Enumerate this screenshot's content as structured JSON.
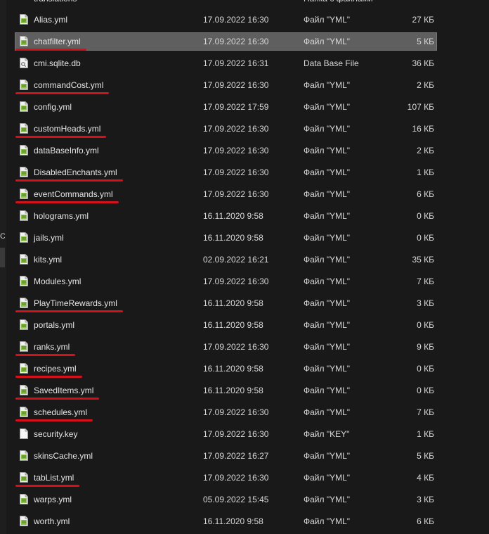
{
  "top_partial": {
    "name": "translations",
    "type": "Папка с файлами"
  },
  "files": [
    {
      "name": "Alias.yml",
      "date": "17.09.2022 16:30",
      "type": "Файл \"YML\"",
      "size": "27 КБ",
      "icon": "yml-file-icon"
    },
    {
      "name": "chatfilter.yml",
      "date": "17.09.2022 16:30",
      "type": "Файл \"YML\"",
      "size": "5 КБ",
      "icon": "yml-file-icon",
      "selected": true,
      "underlined": true
    },
    {
      "name": "cmi.sqlite.db",
      "date": "17.09.2022 16:31",
      "type": "Data Base File",
      "size": "36 КБ",
      "icon": "db-file-icon"
    },
    {
      "name": "commandCost.yml",
      "date": "17.09.2022 16:30",
      "type": "Файл \"YML\"",
      "size": "2 КБ",
      "icon": "yml-file-icon",
      "underlined": true
    },
    {
      "name": "config.yml",
      "date": "17.09.2022 17:59",
      "type": "Файл \"YML\"",
      "size": "107 КБ",
      "icon": "yml-file-icon"
    },
    {
      "name": "customHeads.yml",
      "date": "17.09.2022 16:30",
      "type": "Файл \"YML\"",
      "size": "16 КБ",
      "icon": "yml-file-icon",
      "underlined": true
    },
    {
      "name": "dataBaseInfo.yml",
      "date": "17.09.2022 16:30",
      "type": "Файл \"YML\"",
      "size": "2 КБ",
      "icon": "yml-file-icon"
    },
    {
      "name": "DisabledEnchants.yml",
      "date": "17.09.2022 16:30",
      "type": "Файл \"YML\"",
      "size": "1 КБ",
      "icon": "yml-file-icon",
      "underlined": true
    },
    {
      "name": "eventCommands.yml",
      "date": "17.09.2022 16:30",
      "type": "Файл \"YML\"",
      "size": "6 КБ",
      "icon": "yml-file-icon",
      "underlined": true
    },
    {
      "name": "holograms.yml",
      "date": "16.11.2020 9:58",
      "type": "Файл \"YML\"",
      "size": "0 КБ",
      "icon": "yml-file-icon"
    },
    {
      "name": "jails.yml",
      "date": "16.11.2020 9:58",
      "type": "Файл \"YML\"",
      "size": "0 КБ",
      "icon": "yml-file-icon"
    },
    {
      "name": "kits.yml",
      "date": "02.09.2022 16:21",
      "type": "Файл \"YML\"",
      "size": "35 КБ",
      "icon": "yml-file-icon"
    },
    {
      "name": "Modules.yml",
      "date": "17.09.2022 16:30",
      "type": "Файл \"YML\"",
      "size": "7 КБ",
      "icon": "yml-file-icon"
    },
    {
      "name": "PlayTimeRewards.yml",
      "date": "16.11.2020 9:58",
      "type": "Файл \"YML\"",
      "size": "3 КБ",
      "icon": "yml-file-icon",
      "underlined": true
    },
    {
      "name": "portals.yml",
      "date": "16.11.2020 9:58",
      "type": "Файл \"YML\"",
      "size": "0 КБ",
      "icon": "yml-file-icon"
    },
    {
      "name": "ranks.yml",
      "date": "17.09.2022 16:30",
      "type": "Файл \"YML\"",
      "size": "9 КБ",
      "icon": "yml-file-icon",
      "underlined": true
    },
    {
      "name": "recipes.yml",
      "date": "16.11.2020 9:58",
      "type": "Файл \"YML\"",
      "size": "0 КБ",
      "icon": "yml-file-icon",
      "underlined": true
    },
    {
      "name": "SavedItems.yml",
      "date": "16.11.2020 9:58",
      "type": "Файл \"YML\"",
      "size": "0 КБ",
      "icon": "yml-file-icon",
      "underlined": true
    },
    {
      "name": "schedules.yml",
      "date": "17.09.2022 16:30",
      "type": "Файл \"YML\"",
      "size": "7 КБ",
      "icon": "yml-file-icon",
      "underlined": true
    },
    {
      "name": "security.key",
      "date": "17.09.2022 16:30",
      "type": "Файл \"KEY\"",
      "size": "1 КБ",
      "icon": "blank-file-icon"
    },
    {
      "name": "skinsCache.yml",
      "date": "17.09.2022 16:27",
      "type": "Файл \"YML\"",
      "size": "5 КБ",
      "icon": "yml-file-icon"
    },
    {
      "name": "tabList.yml",
      "date": "17.09.2022 16:30",
      "type": "Файл \"YML\"",
      "size": "4 КБ",
      "icon": "yml-file-icon",
      "underlined": true
    },
    {
      "name": "warps.yml",
      "date": "05.09.2022 15:45",
      "type": "Файл \"YML\"",
      "size": "3 КБ",
      "icon": "yml-file-icon"
    },
    {
      "name": "worth.yml",
      "date": "16.11.2020 9:58",
      "type": "Файл \"YML\"",
      "size": "6 КБ",
      "icon": "yml-file-icon"
    }
  ],
  "colors": {
    "background": "#191919",
    "selection": "#5f5f5f",
    "underline": "#d4101a",
    "yml_icon_accent": "#8bc34a"
  },
  "left_pane_glyph": "C"
}
